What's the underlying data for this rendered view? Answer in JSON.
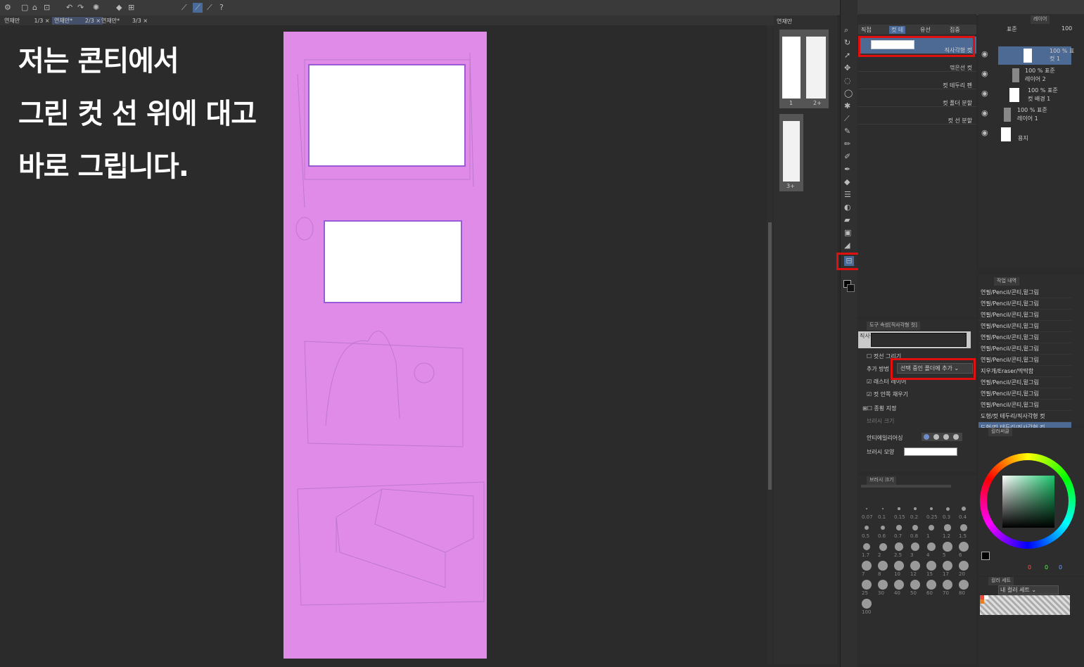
{
  "caption": {
    "line1": "저는 콘티에서",
    "line2": "그린 컷 선 위에 대고",
    "line3": "바로 그립니다."
  },
  "tabs": [
    {
      "label": "연재만",
      "count": "1/3"
    },
    {
      "label": "연재만*",
      "count": "2/3"
    },
    {
      "label": "연재만*",
      "count": "3/3"
    }
  ],
  "navigator": {
    "title": "연재만",
    "page_labels": [
      "1",
      "2+",
      "3+"
    ]
  },
  "subtool": {
    "tabs": [
      "직접",
      "컷 테",
      "유선",
      "집중"
    ],
    "items": [
      {
        "label": "직사각형 컷"
      },
      {
        "label": "꺾은선 컷"
      },
      {
        "label": "컷 테두리 펜"
      },
      {
        "label": "컷 폴더 분할"
      },
      {
        "label": "컷 선 분할"
      }
    ]
  },
  "toolprop": {
    "title": "도구 속성[직사각형 컷]",
    "name_field": "직사각형 컷",
    "draw_cut_label": "컷선 그리기",
    "add_method_label": "추가 방법",
    "add_method_value": "선택 중인 폴더에 추가",
    "raster_label": "래스터 레이어",
    "fill_inside_label": "컷 안쪽 채우기",
    "line_label": "종횡 지정",
    "brush_size_label": "브러시 크기",
    "antialias_label": "안티에일리어싱",
    "brush_shape_label": "브러시 모양"
  },
  "brushsize": {
    "title": "브러시 크기",
    "values": [
      "0.07",
      "0.1",
      "0.15",
      "0.2",
      "0.25",
      "0.3",
      "0.4",
      "0.5",
      "0.6",
      "0.7",
      "0.8",
      "1",
      "1.2",
      "1.5",
      "1.7",
      "2",
      "2.5",
      "3",
      "4",
      "5",
      "6",
      "7",
      "8",
      "10",
      "12",
      "15",
      "17",
      "20",
      "25",
      "30",
      "40",
      "50",
      "60",
      "70",
      "80",
      "100"
    ]
  },
  "layer": {
    "tab": "레이어",
    "blend": "표준",
    "opacity": "100",
    "items": [
      {
        "line1": "100 % 표",
        "line2": "컷 1"
      },
      {
        "line1": "100 % 표준",
        "line2": "레이어 2"
      },
      {
        "line1": "100 % 표준",
        "line2": "컷 배경 1"
      },
      {
        "line1": "100 % 표준",
        "line2": "레이어 1"
      },
      {
        "line1": "",
        "line2": "용지"
      }
    ]
  },
  "history": {
    "title": "작업 내역",
    "items": [
      "연필/Pencil/콘티,밑그림",
      "연필/Pencil/콘티,밑그림",
      "연필/Pencil/콘티,밑그림",
      "연필/Pencil/콘티,밑그림",
      "연필/Pencil/콘티,밑그림",
      "연필/Pencil/콘티,밑그림",
      "연필/Pencil/콘티,밑그림",
      "지우개/Eraser/딱딱함",
      "연필/Pencil/콘티,밑그림",
      "연필/Pencil/콘티,밑그림",
      "연필/Pencil/콘티,밑그림",
      "도형/컷 테두리/직사각형 컷",
      "도형/컷 테두리/직사각형 컷"
    ]
  },
  "colorwheel": {
    "title": "컬러써클",
    "rgb": [
      "0",
      "0",
      "0"
    ]
  },
  "colorset": {
    "title": "컬러 세트",
    "dropdown": "내 컬러 세트"
  }
}
